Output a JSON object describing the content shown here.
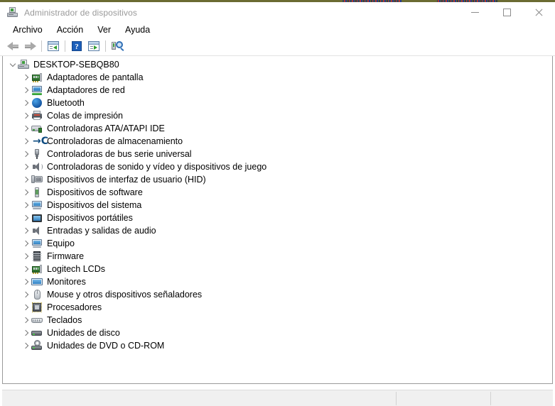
{
  "window": {
    "title": "Administrador de dispositivos",
    "title_icon": "device-manager-icon",
    "caption": {
      "minimize_label": "Minimizar",
      "maximize_label": "Maximizar",
      "close_label": "Cerrar"
    }
  },
  "menubar": {
    "items": [
      {
        "label": "Archivo",
        "name": "menu-archivo"
      },
      {
        "label": "Acción",
        "name": "menu-accion"
      },
      {
        "label": "Ver",
        "name": "menu-ver"
      },
      {
        "label": "Ayuda",
        "name": "menu-ayuda"
      }
    ]
  },
  "toolbar": {
    "buttons": [
      {
        "name": "back-button",
        "icon": "arrow-left-icon",
        "tooltip": "Atrás"
      },
      {
        "name": "forward-button",
        "icon": "arrow-right-icon",
        "tooltip": "Adelante"
      },
      {
        "name": "show-hide-console-tree-button",
        "icon": "console-tree-icon",
        "tooltip": "Mostrar u ocultar árbol de consola"
      },
      {
        "name": "help-button",
        "icon": "help-icon",
        "tooltip": "Ayuda"
      },
      {
        "name": "properties-button",
        "icon": "properties-icon",
        "tooltip": "Propiedades"
      },
      {
        "name": "scan-hardware-changes-button",
        "icon": "scan-hardware-icon",
        "tooltip": "Buscar cambios de hardware"
      }
    ]
  },
  "tree": {
    "root": {
      "label": "DESKTOP-SEBQB80",
      "icon": "computer-root-icon",
      "expanded": true
    },
    "nodes": [
      {
        "label": "Adaptadores de pantalla",
        "icon": "display-adapter-icon",
        "icon_class": "ic-gpu",
        "expanded": false
      },
      {
        "label": "Adaptadores de red",
        "icon": "network-adapter-icon",
        "icon_class": "ic-net",
        "expanded": false
      },
      {
        "label": "Bluetooth",
        "icon": "bluetooth-icon",
        "icon_class": "ic-bt",
        "expanded": false
      },
      {
        "label": "Colas de impresión",
        "icon": "print-queue-icon",
        "icon_class": "ic-print",
        "expanded": false
      },
      {
        "label": "Controladoras ATA/ATAPI IDE",
        "icon": "ata-controller-icon",
        "icon_class": "ic-ata",
        "expanded": false
      },
      {
        "label": "Controladoras de almacenamiento",
        "icon": "storage-controller-icon",
        "icon_class": "ic-stor",
        "expanded": false
      },
      {
        "label": "Controladoras de bus serie universal",
        "icon": "usb-controller-icon",
        "icon_class": "ic-usb",
        "expanded": false
      },
      {
        "label": "Controladoras de sonido y vídeo y dispositivos de juego",
        "icon": "sound-video-game-icon",
        "icon_class": "ic-snd",
        "expanded": false
      },
      {
        "label": "Dispositivos de interfaz de usuario (HID)",
        "icon": "hid-device-icon",
        "icon_class": "ic-hid",
        "expanded": false
      },
      {
        "label": "Dispositivos de software",
        "icon": "software-device-icon",
        "icon_class": "ic-sw",
        "expanded": false
      },
      {
        "label": "Dispositivos del sistema",
        "icon": "system-device-icon",
        "icon_class": "ic-computer",
        "expanded": false
      },
      {
        "label": "Dispositivos portátiles",
        "icon": "portable-device-icon",
        "icon_class": "ic-port",
        "expanded": false
      },
      {
        "label": "Entradas y salidas de audio",
        "icon": "audio-io-icon",
        "icon_class": "ic-audio",
        "expanded": false
      },
      {
        "label": "Equipo",
        "icon": "computer-icon",
        "icon_class": "ic-computer",
        "expanded": false
      },
      {
        "label": "Firmware",
        "icon": "firmware-icon",
        "icon_class": "ic-fw",
        "expanded": false
      },
      {
        "label": "Logitech LCDs",
        "icon": "logitech-lcd-icon",
        "icon_class": "ic-gpu",
        "expanded": false
      },
      {
        "label": "Monitores",
        "icon": "monitor-icon",
        "icon_class": "ic-mon",
        "expanded": false
      },
      {
        "label": "Mouse y otros dispositivos señaladores",
        "icon": "mouse-icon",
        "icon_class": "ic-mouse",
        "expanded": false
      },
      {
        "label": "Procesadores",
        "icon": "processor-icon",
        "icon_class": "ic-cpu",
        "expanded": false
      },
      {
        "label": "Teclados",
        "icon": "keyboard-icon",
        "icon_class": "ic-kb",
        "expanded": false
      },
      {
        "label": "Unidades de disco",
        "icon": "disk-drive-icon",
        "icon_class": "ic-disk",
        "expanded": false
      },
      {
        "label": "Unidades de DVD o CD-ROM",
        "icon": "dvd-drive-icon",
        "icon_class": "ic-dvd",
        "expanded": false
      }
    ]
  },
  "statusbar": {
    "panel1": "",
    "panel2": "",
    "panel3": ""
  },
  "colors": {
    "window_background": "#ffffff",
    "title_text": "#9a9a9a",
    "menu_text": "#000000",
    "tree_text": "#000000",
    "chevron": "#767676",
    "statusbar_background": "#f0f0f0",
    "border": "#9a9a9a"
  }
}
